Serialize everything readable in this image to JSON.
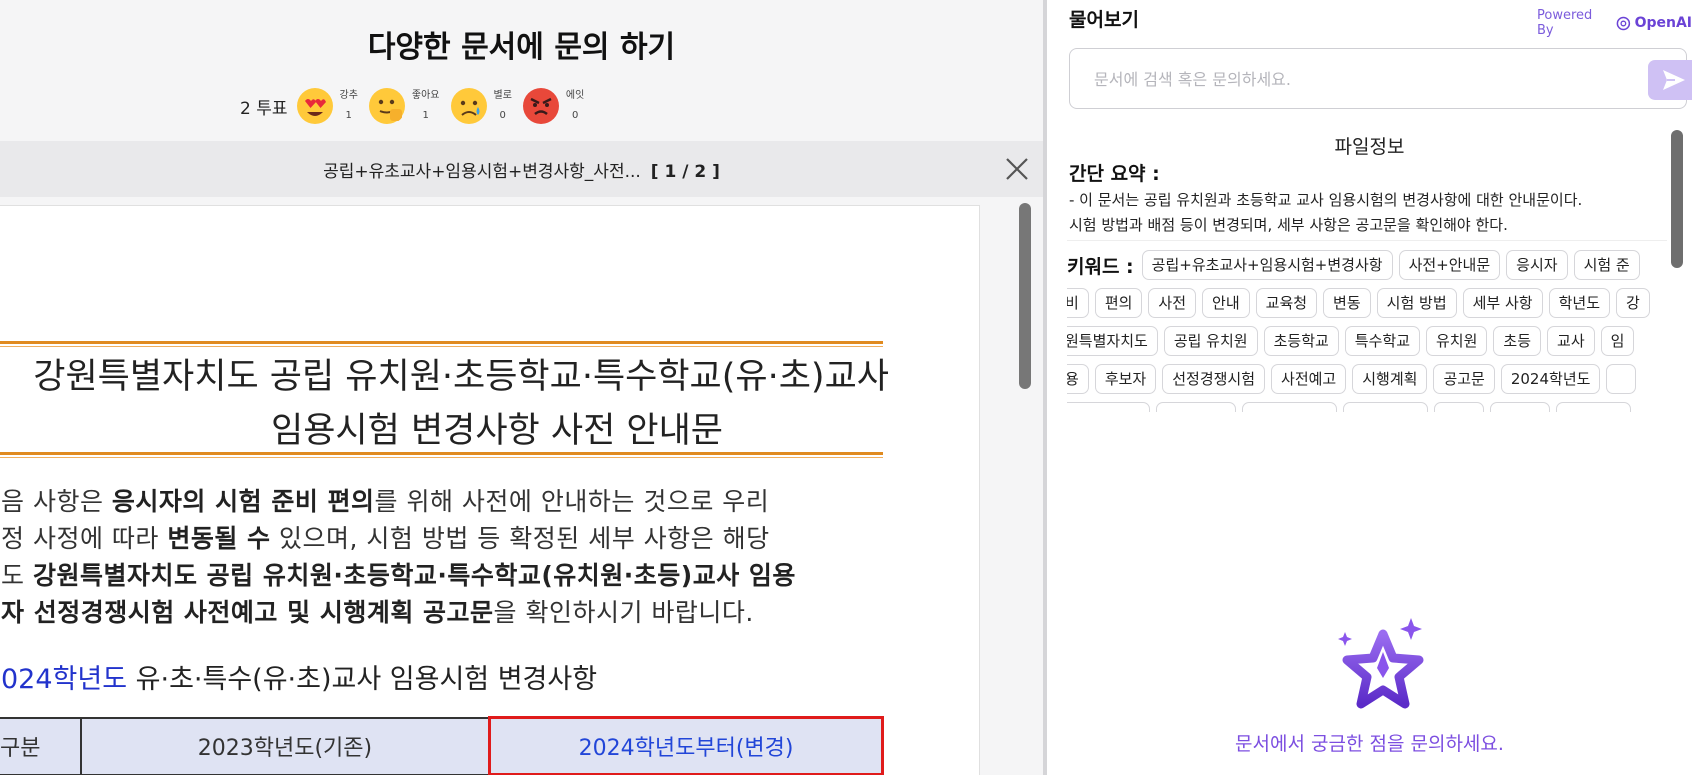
{
  "document": {
    "title": "다양한 문서에 문의 하기",
    "votes": {
      "count_label": "2 투표",
      "reactions": [
        {
          "icon": "heart-eyes-emoji-icon",
          "label": "강추",
          "count": "1"
        },
        {
          "icon": "thumbs-up-emoji-icon",
          "label": "좋아요",
          "count": "1"
        },
        {
          "icon": "sad-emoji-icon",
          "label": "별로",
          "count": "0"
        },
        {
          "icon": "angry-emoji-icon",
          "label": "에잇",
          "count": "0"
        }
      ]
    },
    "viewer": {
      "file_name": "공립+유초교사+임용시험+변경사항_사전...",
      "page_indicator": "[ 1 / 2 ]",
      "close_icon": "close-icon"
    },
    "page": {
      "heading_line1": "강원특별자치도 공립 유치원·초등학교·특수학교(유·초)교사",
      "heading_line2": "임용시험 변경사항 사전 안내문",
      "para": [
        {
          "pre": "음 사항은 ",
          "bold": "응시자의 시험 준비 편의",
          "post": "를 위해 사전에 안내하는 것으로 우리"
        },
        {
          "pre": "정 사정에 따라 ",
          "bold": "변동될 수",
          "post": " 있으며, 시험 방법 등 확정된 세부 사항은 해당"
        },
        {
          "pre": "도 ",
          "bold": "강원특별자치도 공립 유치원·초등학교·특수학교(유치원·초등)교사 임용",
          "post": ""
        },
        {
          "pre": "",
          "bold": "자 선정경쟁시험 사전예고 및 시행계획 공고문",
          "post": "을 확인하시기 바랍니다."
        }
      ],
      "section_heading_blue": "024학년도",
      "section_heading_rest": " 유·초·특수(유·초)교사 임용시험 변경사항",
      "table_headers": [
        "구분",
        "2023학년도(기존)",
        "2024학년도부터(변경)"
      ]
    }
  },
  "ask_panel": {
    "title": "물어보기",
    "powered_by": "Powered By",
    "powered_brand": "OpenAI",
    "search": {
      "placeholder": "문서에 검색 혹은 문의하세요.",
      "value": ""
    },
    "file_info_title": "파일정보",
    "summary_title": "간단 요약 :",
    "summary_line1": "- 이 문서는 공립 유치원과 초등학교 교사 임용시험의 변경사항에 대한 안내문이다.",
    "summary_line2": "시험 방법과 배점 등이 변경되며, 세부 사항은 공고문을 확인해야 한다.",
    "keywords_label": "키워드 :",
    "keyword_rows": [
      [
        "공립+유초교사+임용시험+변경사항",
        "사전+안내문",
        "응시자",
        "시험 준"
      ],
      [
        "비",
        "편의",
        "사전",
        "안내",
        "교육청",
        "변동",
        "시험 방법",
        "세부 사항",
        "학년도",
        "강"
      ],
      [
        "원특별자치도",
        "공립 유치원",
        "초등학교",
        "특수학교",
        "유치원",
        "초등",
        "교사",
        "임"
      ],
      [
        "용",
        "후보자",
        "선정경쟁시험",
        "사전예고",
        "시행계획",
        "공고문",
        "2024학년도",
        ""
      ]
    ],
    "empty_state_text": "문서에서 궁금한 점을 문의하세요.",
    "colors": {
      "accent": "#7c4ee0",
      "send_button": "#cfc1f4"
    }
  }
}
